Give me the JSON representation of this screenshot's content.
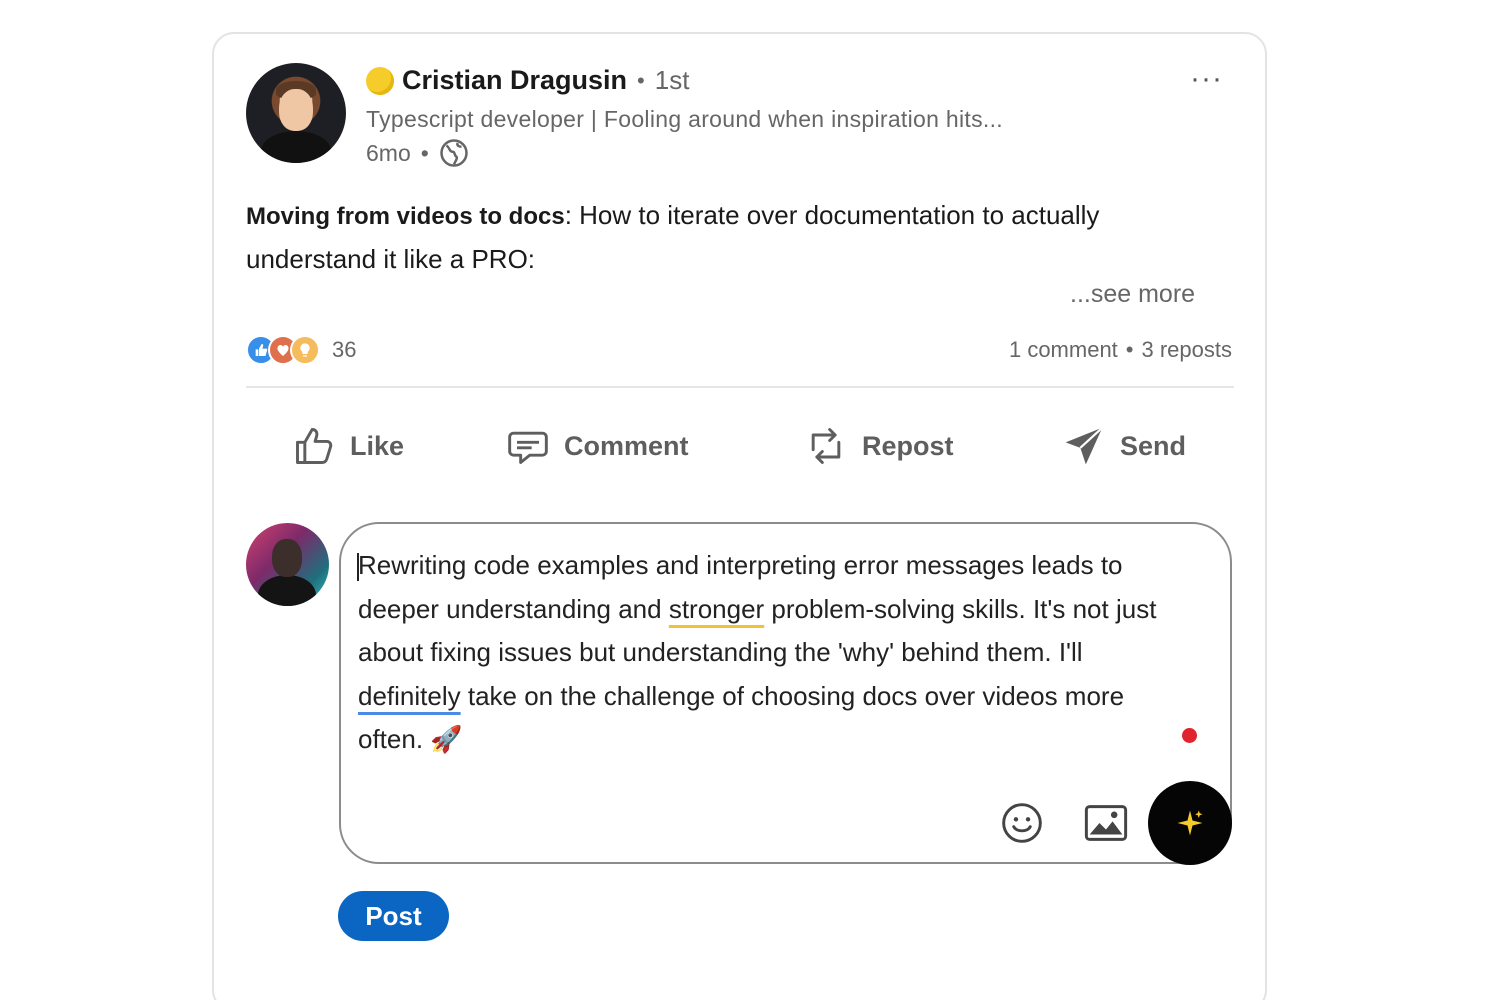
{
  "post": {
    "author": {
      "name": "Cristian Dragusin",
      "separator": "•",
      "degree": "1st",
      "headline": "Typescript developer | Fooling around when inspiration hits...",
      "time": "6mo",
      "time_separator": "•",
      "visibility_icon": "globe-icon",
      "status_emoji_color": "#f6cc2a"
    },
    "menu_label": "···",
    "body": {
      "bold_lead": "Moving from videos to docs",
      "text": ": How to iterate over documentation to actually understand it like a PRO:",
      "see_more": "...see more"
    },
    "social": {
      "reaction_icons": [
        "like-reaction-icon",
        "love-reaction-icon",
        "insightful-reaction-icon"
      ],
      "reaction_count": "36",
      "comments": "1 comment",
      "separator": "•",
      "reposts": "3 reposts"
    },
    "actions": {
      "like": "Like",
      "comment": "Comment",
      "repost": "Repost",
      "send": "Send"
    }
  },
  "composer": {
    "text_part1": "Rewriting code examples and interpreting error messages leads to deeper understanding and ",
    "underlined_yellow": "stronger",
    "text_part2": " problem-solving skills. It's not just about fixing issues but understanding the 'why' behind them. I'll ",
    "underlined_blue": "definitely",
    "text_part3": " take on the challenge of choosing docs over videos more often. ",
    "emoji": "🚀",
    "tools": [
      "emoji-icon",
      "image-icon",
      "ai-sparkle-icon"
    ],
    "post_label": "Post",
    "brand_color": "#0a66c2"
  }
}
